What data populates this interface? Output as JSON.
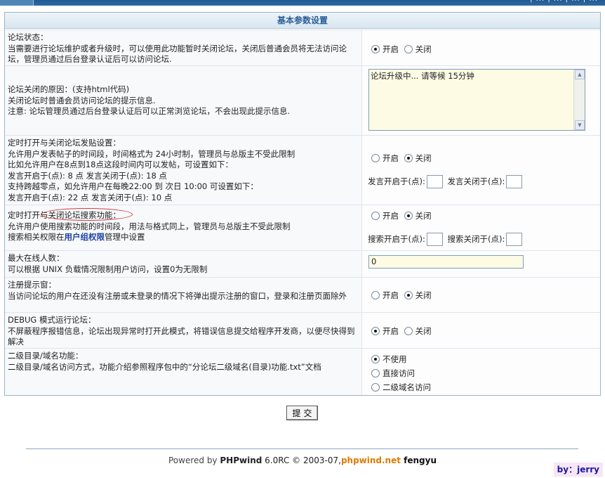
{
  "topbar": {
    "nav_text": "| ... | ... | ... | ..."
  },
  "panel": {
    "title": "基本参数设置"
  },
  "rows": {
    "forum_status": {
      "title": "论坛状态：",
      "desc": "当需要进行论坛维护或者升级时，可以使用此功能暂时关闭论坛，关闭后普通会员将无法访问论坛，管理员通过后台登录认证后可以访问论坛.",
      "opt_on": "开启",
      "opt_off": "关闭"
    },
    "close_reason": {
      "title": "论坛关闭的原因：(支持html代码)",
      "desc1": "关闭论坛时普通会员访问论坛的提示信息.",
      "desc2": "注意: 论坛管理员通过后台登录认证后可以正常浏览论坛，不会出现此提示信息.",
      "value": "论坛升级中... 请等候 15分钟"
    },
    "post_schedule": {
      "title": "定时打开与关闭论坛发贴设置：",
      "line1": "允许用户发表帖子的时间段，时间格式为 24小时制，管理员与总版主不受此限制",
      "line2": "比如允许用户在8点到18点这段时间内可以发帖，可设置如下：",
      "line3": "发言开启于(点): 8 点 发言关闭于(点): 18 点",
      "line4": "支持跨越零点，如允许用户在每晚22:00 到 次日 10:00 可设置如下：",
      "line5": "发言开启于(点): 22 点 发言关闭于(点): 10 点",
      "opt_on": "开启",
      "opt_off": "关闭",
      "start_label": "发言开启于(点):",
      "end_label": "发言关闭于(点):"
    },
    "search_schedule": {
      "title_pre": "定时打开",
      "title_hl": "与关闭论坛搜索功能：",
      "line1": "允许用户使用搜索功能的时间段，用法与格式同上，管理员与总版主不受此限制",
      "line2_pre": "搜索相关权限在",
      "line2_link": "用户组权限",
      "line2_post": "管理中设置",
      "opt_on": "开启",
      "opt_off": "关闭",
      "start_label": "搜索开启于(点):",
      "end_label": "搜索关闭于(点):"
    },
    "max_online": {
      "title": "最大在线人数：",
      "desc": "可以根据 UNIX 负载情况限制用户访问，设置0为无限制",
      "value": "0"
    },
    "register_prompt": {
      "title": "注册提示窗：",
      "desc": "当访问论坛的用户在还没有注册或未登录的情况下将弹出提示注册的窗口，登录和注册页面除外",
      "opt_on": "开启",
      "opt_off": "关闭"
    },
    "debug_mode": {
      "title": "DEBUG 模式运行论坛：",
      "desc": "不屏蔽程序报错信息，论坛出现异常时打开此模式，将错误信息提交给程序开发商，以便尽快得到解决",
      "opt_on": "开启",
      "opt_off": "关闭"
    },
    "subdomain": {
      "title": "二级目录/域名功能：",
      "desc": "二级目录/域名访问方式，功能介绍参照程序包中的“分论坛二级域名(目录)功能.txt”文档",
      "opt_none": "不使用",
      "opt_dir": "直接访问",
      "opt_domain": "二级域名访问"
    }
  },
  "submit_label": "提交",
  "footer": {
    "powered": "Powered by ",
    "brand": "PHPwind",
    "version": " 6.0RC © 2003-07,",
    "site": "phpwind.net",
    "author": " fengyu"
  },
  "byline": "by：jerry"
}
